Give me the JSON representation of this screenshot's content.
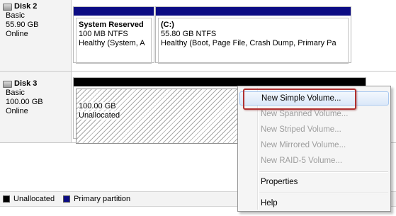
{
  "disks": [
    {
      "name": "Disk 2",
      "type": "Basic",
      "size": "55.90 GB",
      "status": "Online",
      "volumes": [
        {
          "name": "System Reserved",
          "size_fs": "100 MB NTFS",
          "status": "Healthy (System, A"
        },
        {
          "name": "(C:)",
          "size_fs": "55.80 GB NTFS",
          "status": "Healthy (Boot, Page File, Crash Dump, Primary Pa"
        }
      ]
    },
    {
      "name": "Disk 3",
      "type": "Basic",
      "size": "100.00 GB",
      "status": "Online",
      "volumes": [
        {
          "size": "100.00 GB",
          "state": "Unallocated"
        }
      ]
    }
  ],
  "legend": {
    "items": [
      {
        "label": "Unallocated",
        "color": "#000000"
      },
      {
        "label": "Primary partition",
        "color": "#0c0c84"
      }
    ]
  },
  "context_menu": {
    "items": [
      {
        "label": "New Simple Volume...",
        "enabled": true,
        "highlighted": true
      },
      {
        "label": "New Spanned Volume...",
        "enabled": false
      },
      {
        "label": "New Striped Volume...",
        "enabled": false
      },
      {
        "label": "New Mirrored Volume...",
        "enabled": false
      },
      {
        "label": "New RAID-5 Volume...",
        "enabled": false
      },
      {
        "label": "Properties",
        "enabled": true
      },
      {
        "label": "Help",
        "enabled": true
      }
    ]
  },
  "colors": {
    "primary_partition": "#0c0c84",
    "unallocated": "#000000",
    "callout_border": "#b03030"
  }
}
